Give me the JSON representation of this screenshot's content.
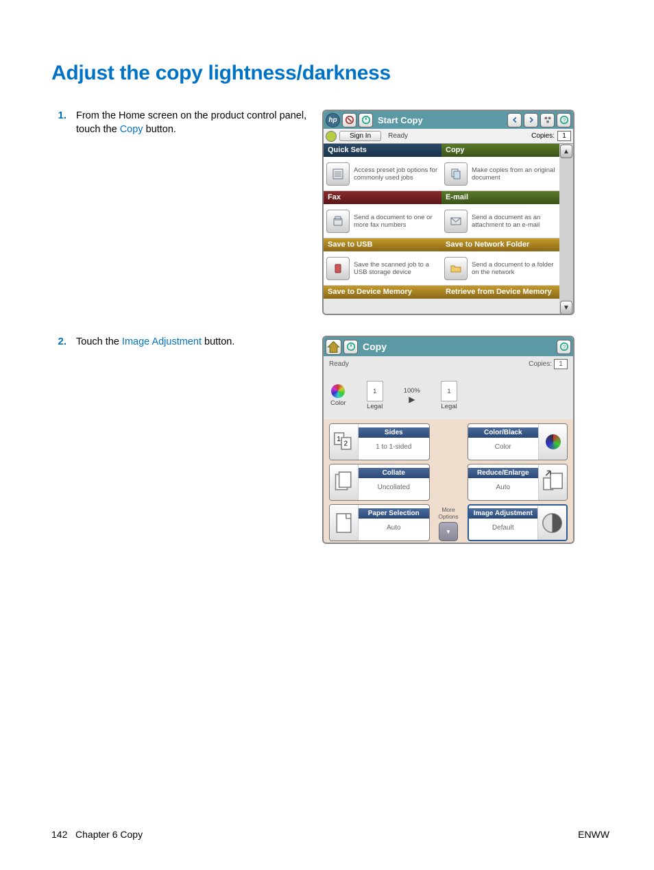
{
  "page": {
    "title": "Adjust the copy lightness/darkness",
    "number": "142",
    "chapter": "Chapter 6   Copy",
    "region": "ENWW"
  },
  "steps": {
    "s1_num": "1.",
    "s1_pre": "From the Home screen on the product control panel, touch the ",
    "s1_link": "Copy",
    "s1_post": " button.",
    "s2_num": "2.",
    "s2_pre": "Touch the ",
    "s2_link": "Image Adjustment",
    "s2_post": " button."
  },
  "scr1": {
    "topbar_title": "Start Copy",
    "signin": "Sign In",
    "status": "Ready",
    "copies_label": "Copies:",
    "copies_val": "1",
    "tiles": {
      "quicksets_hdr": "Quick Sets",
      "quicksets_desc": "Access preset job options for commonly used jobs",
      "copy_hdr": "Copy",
      "copy_desc": "Make copies from an original document",
      "fax_hdr": "Fax",
      "fax_desc": "Send a document to one or more fax numbers",
      "email_hdr": "E-mail",
      "email_desc": "Send a document as an attachment to an e-mail",
      "usb_hdr": "Save to USB",
      "usb_desc": "Save the scanned job to a USB storage device",
      "net_hdr": "Save to Network Folder",
      "net_desc": "Send a document to a folder on the network",
      "savedev_hdr": "Save to Device Memory",
      "retdev_hdr": "Retrieve from Device Memory"
    }
  },
  "scr2": {
    "topbar_title": "Copy",
    "status": "Ready",
    "copies_label": "Copies:",
    "copies_val": "1",
    "preview": {
      "color_label": "Color",
      "pct": "100%",
      "size1": "Legal",
      "size2": "Legal",
      "one": "1"
    },
    "opts": {
      "sides_t": "Sides",
      "sides_v": "1 to 1-sided",
      "collate_t": "Collate",
      "collate_v": "Uncollated",
      "paper_t": "Paper Selection",
      "paper_v": "Auto",
      "colorblack_t": "Color/Black",
      "colorblack_v": "Color",
      "reduce_t": "Reduce/Enlarge",
      "reduce_v": "Auto",
      "imgadj_t": "Image Adjustment",
      "imgadj_v": "Default",
      "more": "More Options"
    }
  }
}
